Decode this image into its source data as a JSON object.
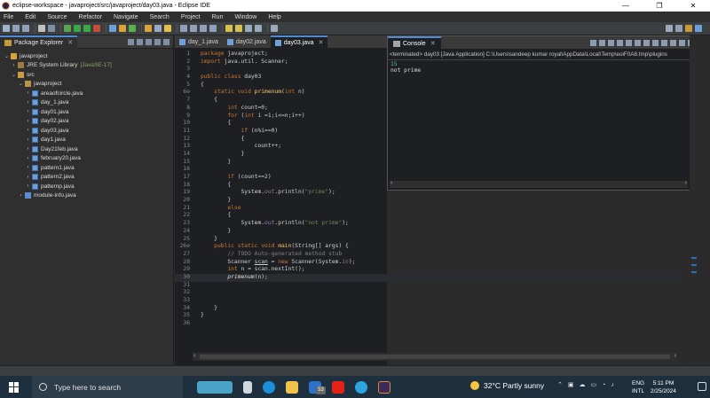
{
  "window": {
    "title": "eclipse-workspace - javaproject/src/javaproject/day03.java - Eclipse IDE",
    "min": "—",
    "max": "❐",
    "close": "✕"
  },
  "menu": [
    "File",
    "Edit",
    "Source",
    "Refactor",
    "Navigate",
    "Search",
    "Project",
    "Run",
    "Window",
    "Help"
  ],
  "package_explorer": {
    "tab_label": "Package Explorer",
    "items": [
      {
        "label": "javaproject",
        "extra": ""
      },
      {
        "label": "JRE System Library",
        "extra": "[JavaSE-17]"
      },
      {
        "label": "src",
        "extra": ""
      },
      {
        "label": "javaproject",
        "extra": ""
      },
      {
        "label": "areaofcircle.java",
        "extra": ""
      },
      {
        "label": "day_1.java",
        "extra": ""
      },
      {
        "label": "day01.java",
        "extra": ""
      },
      {
        "label": "day02.java",
        "extra": ""
      },
      {
        "label": "day03.java",
        "extra": ""
      },
      {
        "label": "day1.java",
        "extra": ""
      },
      {
        "label": "Day21feb.java",
        "extra": ""
      },
      {
        "label": "february20.java",
        "extra": ""
      },
      {
        "label": "pattern1.java",
        "extra": ""
      },
      {
        "label": "pattern2.java",
        "extra": ""
      },
      {
        "label": "patternp.java",
        "extra": ""
      },
      {
        "label": "module-info.java",
        "extra": ""
      }
    ]
  },
  "editor": {
    "tabs": [
      "day_1.java",
      "day02.java",
      "day03.java"
    ],
    "active_tab": "day03.java"
  },
  "console": {
    "tab_label": "Console",
    "terminated": "<terminated> day03 [Java Application] C:\\Users\\sandeep kumar royal\\AppData\\Local\\Temp\\eoiF0A8.tmp\\plugins",
    "input_line": "15",
    "output_line": "not prime"
  },
  "taskbar": {
    "search_placeholder": "Type here to search",
    "mail_badge": "53",
    "weather": "32°C  Partly sunny",
    "lang_top": "ENG",
    "lang_bottom": "INTL",
    "time": "5:11 PM",
    "date": "2/25/2024"
  },
  "colors": {
    "keyword": "#cc7832",
    "string": "#6a8759",
    "comment": "#808080",
    "field": "#9876aa",
    "method": "#ffc66d",
    "accent": "#4f8ad6"
  }
}
